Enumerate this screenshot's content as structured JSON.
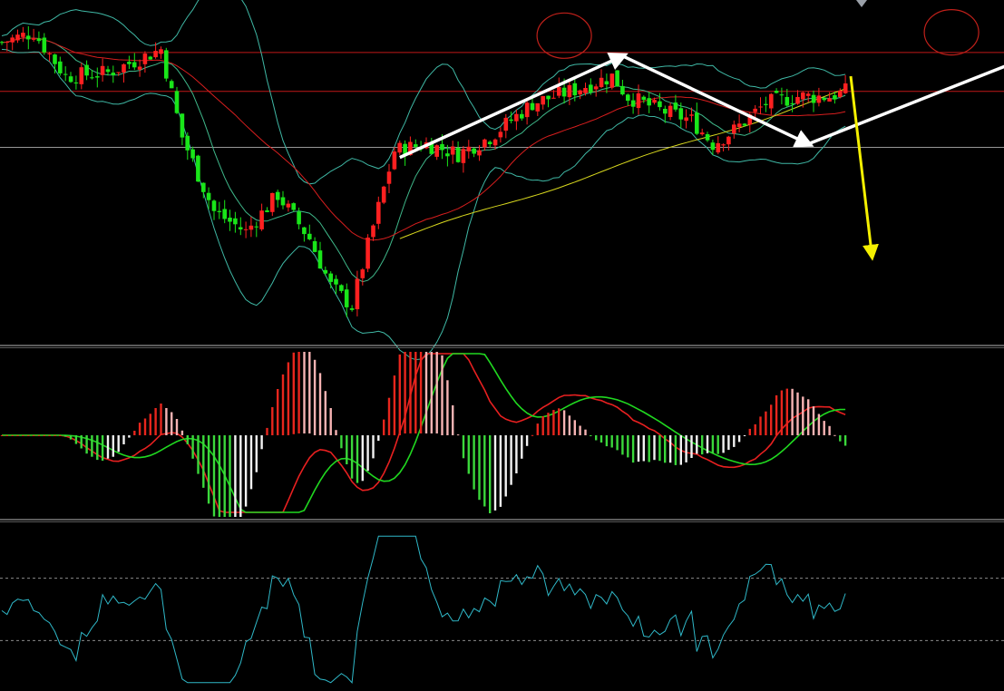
{
  "chart_data": [
    {
      "panel": "price",
      "type": "candlestick",
      "title": "",
      "xlabel": "",
      "ylabel": "",
      "ylim": [
        0,
        100
      ],
      "grid": false,
      "colors": {
        "up": "#ff2020",
        "down": "#19e619",
        "bb": "#3fb8a5",
        "ma_mid": "#3fb88a",
        "ma_red": "#d81e1e",
        "ma_long": "#d8d81e",
        "hline": "#c01818",
        "hline2": "#c8c8c8"
      },
      "horizontal_levels": [
        85,
        73.5
      ],
      "horizontal_level_grey": 57,
      "candles": [],
      "overlays": [
        "bollinger-upper",
        "bollinger-middle",
        "bollinger-lower",
        "ma-red",
        "ma-long"
      ],
      "annotations": {
        "white_arrows": [
          {
            "from": [
              115,
              54
            ],
            "to": [
              157,
              84
            ]
          },
          {
            "from": [
              157,
              84
            ],
            "to": [
              192,
              58
            ]
          },
          {
            "from": [
              192,
              58
            ],
            "to": [
              234,
              84
            ]
          }
        ],
        "yellow_arrow": {
          "from": [
            233,
            60
          ],
          "to": [
            242,
            25
          ]
        },
        "red_ellipses": [
          {
            "cx": 154,
            "cy": 90
          },
          {
            "cx": 227,
            "cy": 91
          }
        ]
      }
    },
    {
      "panel": "macd",
      "type": "bar",
      "title": "",
      "ylim": [
        -100,
        100
      ],
      "colors": {
        "pos_up": "#e8261d",
        "pos_down": "#f7b3b3",
        "neg_down": "#3bd83b",
        "neg_up": "#f2f2f2",
        "dif": "#e82020",
        "dea": "#20d820"
      }
    },
    {
      "panel": "oscillator",
      "type": "line",
      "title": "",
      "ylim": [
        0,
        100
      ],
      "levels": [
        70,
        30
      ],
      "colors": {
        "line": "#2fb8c8",
        "levels": "#8a8a8a"
      }
    }
  ]
}
